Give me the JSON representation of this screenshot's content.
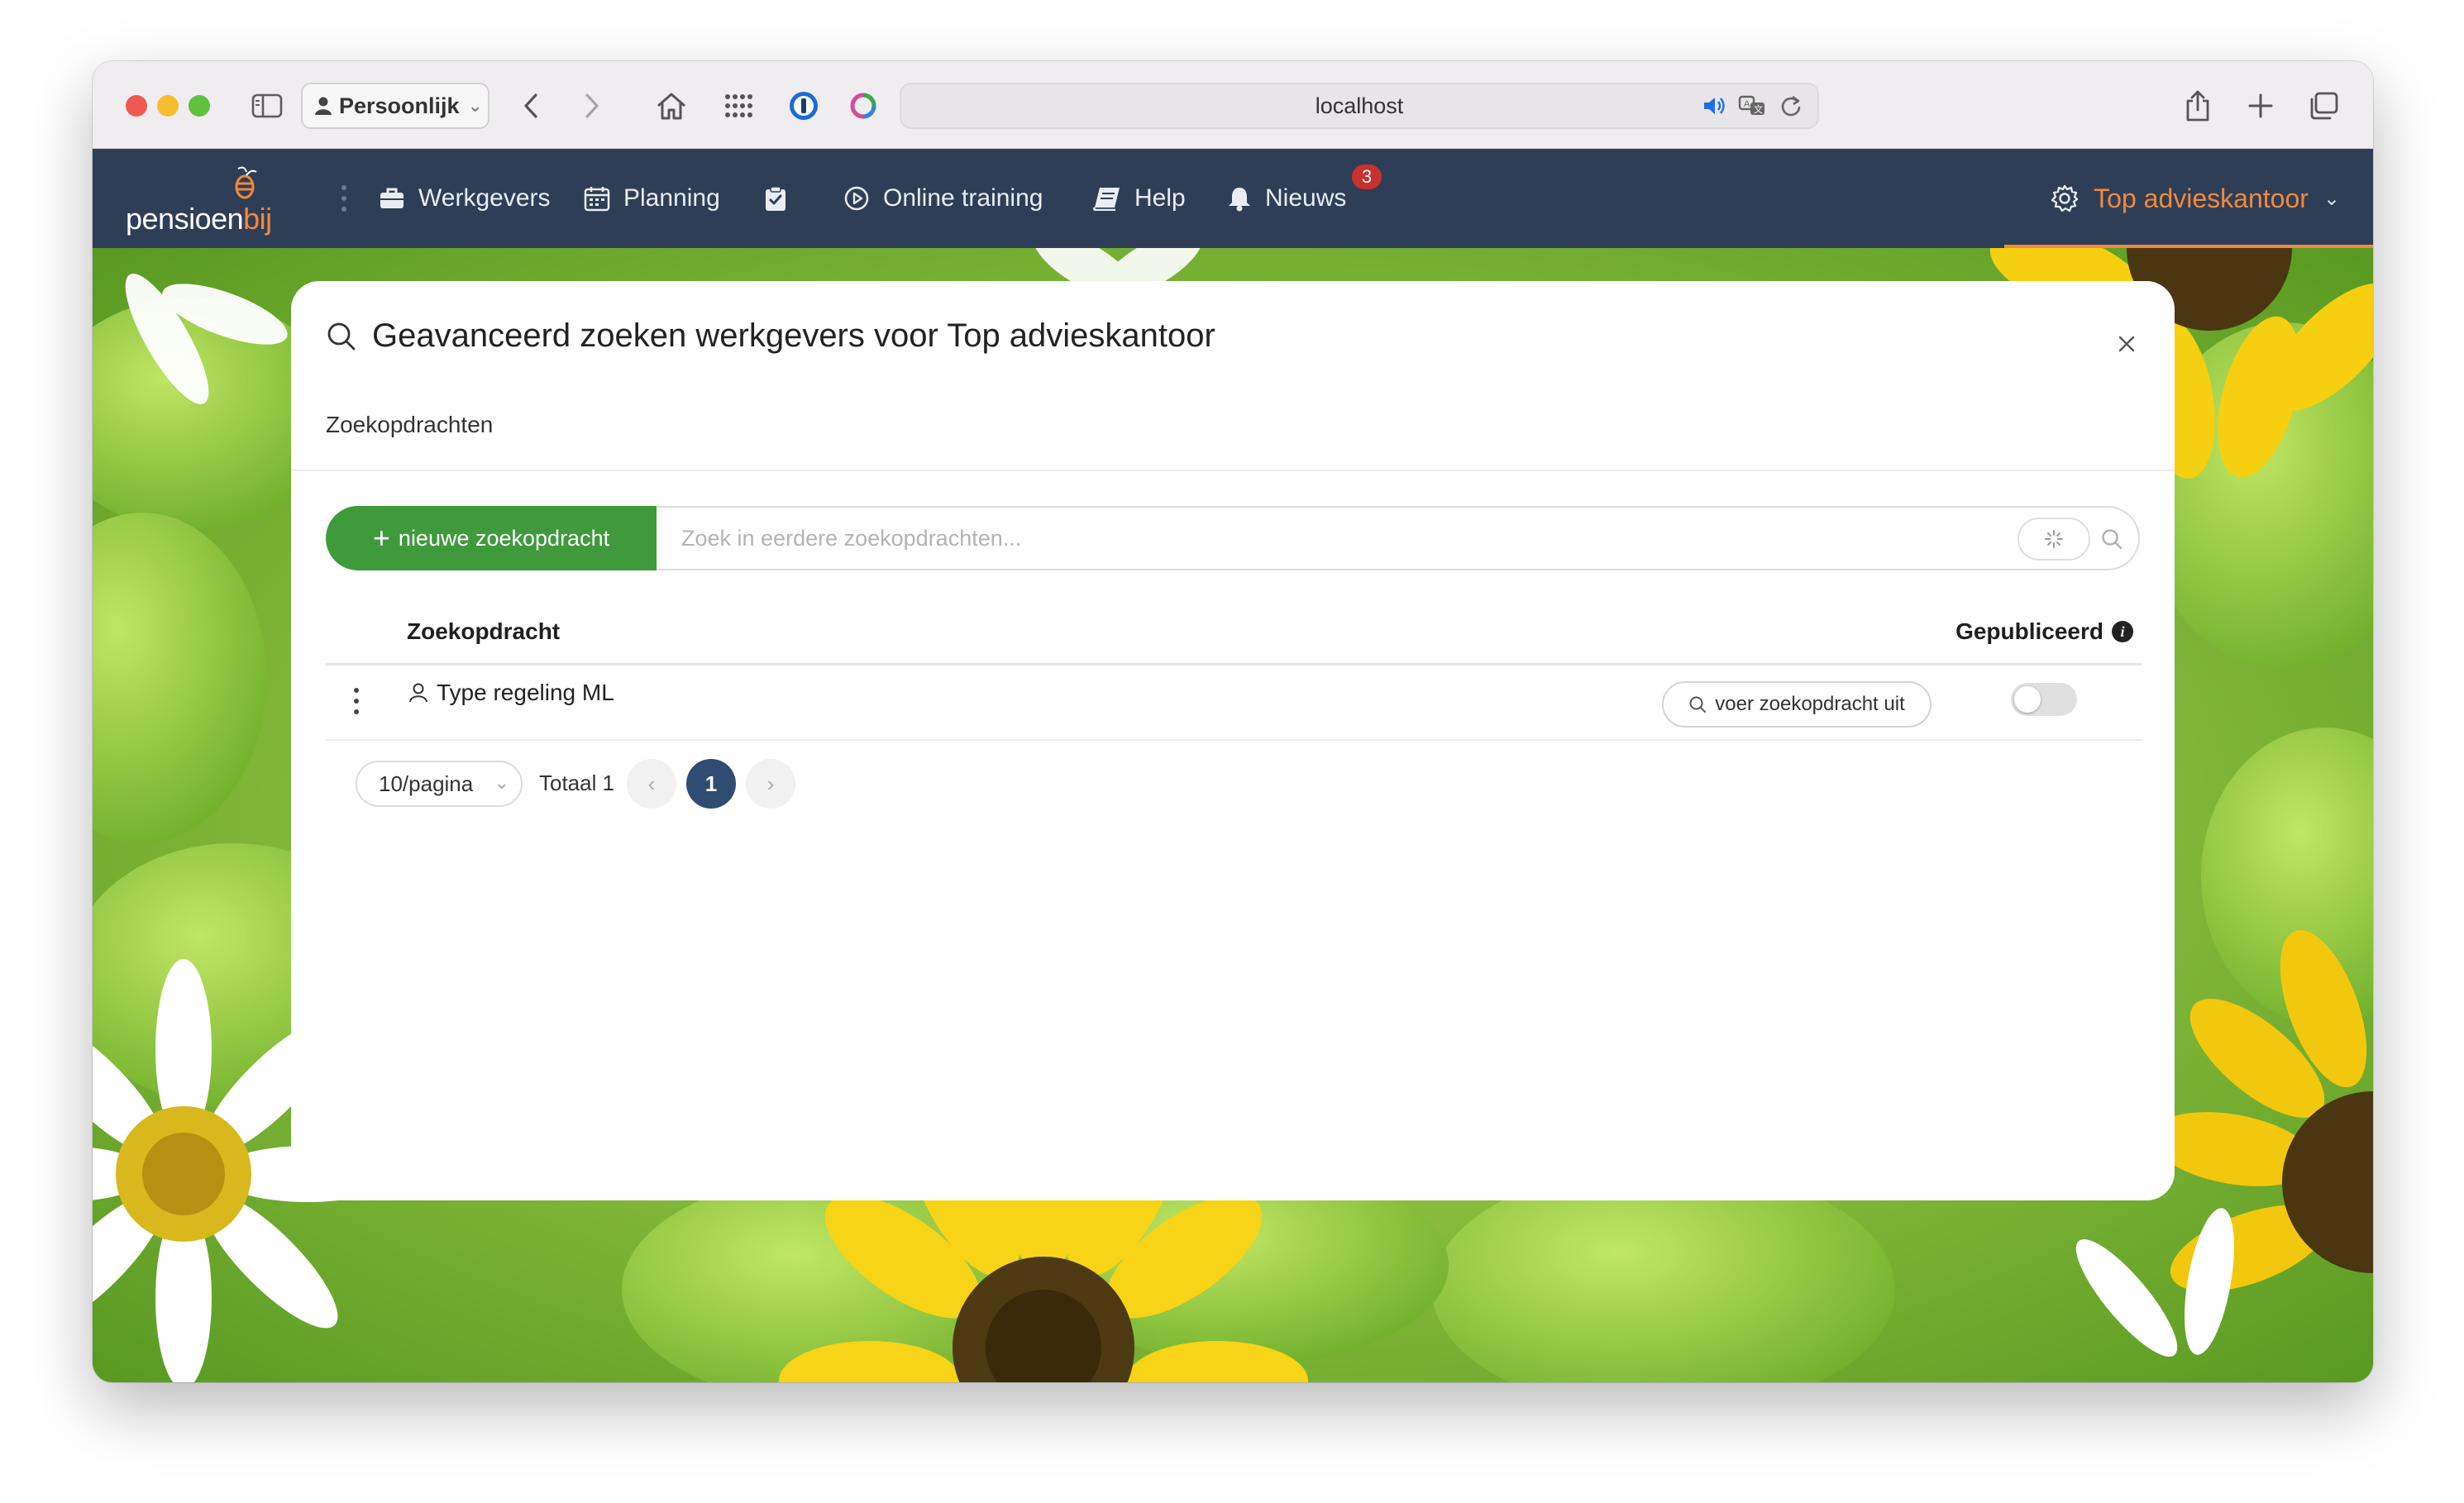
{
  "browser": {
    "profile_label": "Persoonlijk",
    "url": "localhost"
  },
  "nav": {
    "logo_text_main": "pensioen",
    "logo_text_accent": "bij",
    "items": [
      {
        "label": "Werkgevers"
      },
      {
        "label": "Planning"
      },
      {
        "label": "Online training"
      },
      {
        "label": "Help"
      },
      {
        "label": "Nieuws",
        "badge": "3"
      }
    ],
    "organization": "Top advieskantoor"
  },
  "modal": {
    "title": "Geavanceerd zoeken werkgevers voor Top advieskantoor",
    "tab_label": "Zoekopdrachten",
    "new_button_label": "nieuwe zoekopdracht",
    "search_placeholder": "Zoek in eerdere zoekopdrachten...",
    "search_value": "",
    "table": {
      "columns": [
        "Zoekopdracht",
        "Gepubliceerd"
      ],
      "rows": [
        {
          "name": "Type regeling ML",
          "action_label": "voer zoekopdracht uit",
          "published": false
        }
      ]
    },
    "pagination": {
      "page_size": "10/pagina",
      "total_label": "Totaal 1",
      "current_page": "1"
    }
  },
  "colors": {
    "nav_bg": "#2f3e57",
    "accent_orange": "#f08a3c",
    "primary_green": "#3f9a3c",
    "active_page": "#2f4d73",
    "badge_red": "#c8312c"
  }
}
